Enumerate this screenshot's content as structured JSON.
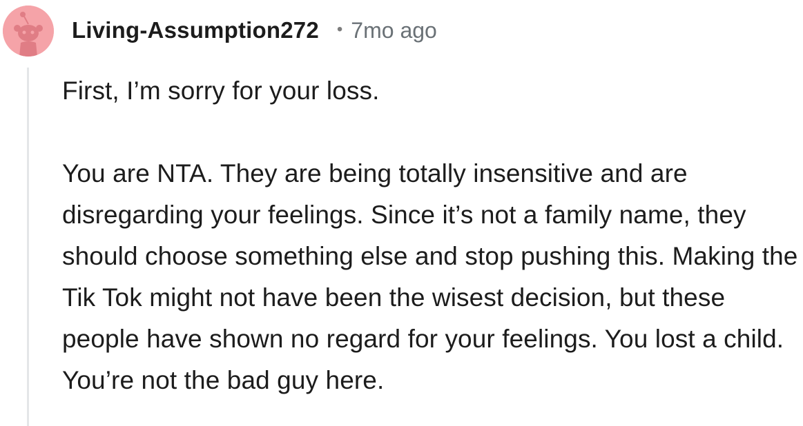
{
  "comment": {
    "author": "Living-Assumption272",
    "separator": "•",
    "timestamp": "7mo ago",
    "avatar_icon": "snoo-avatar-icon",
    "avatar_color": "#f5a3a8",
    "paragraphs": [
      "First, I’m sorry for your loss.",
      "You are NTA. They are being totally insensitive and are disregarding your feelings. Since it’s not a family name, they should choose something else and stop pushing this. Making the Tik Tok might not have been the wisest decision, but these people have shown no regard for your feelings. You lost a child. You’re not the bad guy here."
    ]
  },
  "colors": {
    "text": "#1c1c1c",
    "meta": "#6a7176",
    "thread_line": "#e4e6e8"
  }
}
